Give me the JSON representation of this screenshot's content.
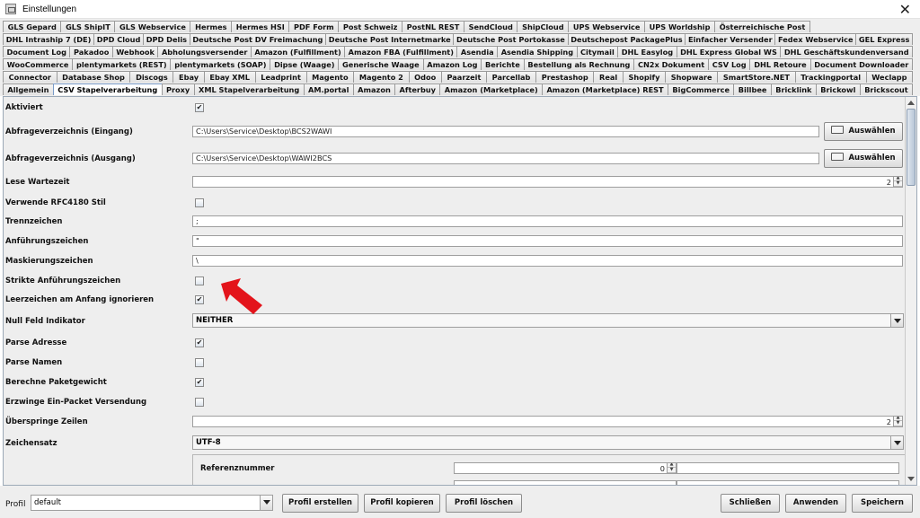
{
  "window": {
    "title": "Einstellungen",
    "close_glyph": "✕",
    "icon": "app-window-icon"
  },
  "tabs": {
    "row1": [
      "GLS Gepard",
      "GLS ShipIT",
      "GLS Webservice",
      "Hermes",
      "Hermes HSI",
      "PDF Form",
      "Post Schweiz",
      "PostNL REST",
      "SendCloud",
      "ShipCloud",
      "UPS Webservice",
      "UPS Worldship",
      "Österreichische Post"
    ],
    "row2": [
      "DHL Intraship 7 (DE)",
      "DPD Cloud",
      "DPD Delis",
      "Deutsche Post DV Freimachung",
      "Deutsche Post Internetmarke",
      "Deutsche Post Portokasse",
      "Deutschepost PackagePlus",
      "Einfacher Versender",
      "Fedex Webservice",
      "GEL Express"
    ],
    "row3": [
      "Document Log",
      "Pakadoo",
      "Webhook",
      "Abholungsversender",
      "Amazon (Fulfillment)",
      "Amazon FBA (Fulfillment)",
      "Asendia",
      "Asendia Shipping",
      "Citymail",
      "DHL Easylog",
      "DHL Express Global WS",
      "DHL Geschäftskundenversand"
    ],
    "row4": [
      "WooCommerce",
      "plentymarkets (REST)",
      "plentymarkets (SOAP)",
      "Dipse (Waage)",
      "Generische Waage",
      "Amazon Log",
      "Berichte",
      "Bestellung als Rechnung",
      "CN2x Dokument",
      "CSV Log",
      "DHL Retoure",
      "Document Downloader"
    ],
    "row5": [
      "Connector",
      "Database Shop",
      "Discogs",
      "Ebay",
      "Ebay XML",
      "Leadprint",
      "Magento",
      "Magento 2",
      "Odoo",
      "Paarzeit",
      "Parcellab",
      "Prestashop",
      "Real",
      "Shopify",
      "Shopware",
      "SmartStore.NET",
      "Trackingportal",
      "Weclapp"
    ],
    "row6": [
      "Allgemein",
      "CSV Stapelverarbeitung",
      "Proxy",
      "XML Stapelverarbeitung",
      "AM.portal",
      "Amazon",
      "Afterbuy",
      "Amazon (Marketplace)",
      "Amazon (Marketplace) REST",
      "BigCommerce",
      "Billbee",
      "Bricklink",
      "Brickowl",
      "Brickscout"
    ],
    "active": "CSV Stapelverarbeitung"
  },
  "form": {
    "aktiviert": {
      "label": "Aktiviert",
      "checked": true
    },
    "input_dir": {
      "label": "Abfrageverzeichnis (Eingang)",
      "value": "C:\\Users\\Service\\Desktop\\BCS2WAWI",
      "button": "Auswählen"
    },
    "output_dir": {
      "label": "Abfrageverzeichnis (Ausgang)",
      "value": "C:\\Users\\Service\\Desktop\\WAWI2BCS",
      "button": "Auswählen"
    },
    "lese_wartezeit": {
      "label": "Lese Wartezeit",
      "value": "2"
    },
    "rfc4180": {
      "label": "Verwende RFC4180 Stil",
      "checked": false
    },
    "trennzeichen": {
      "label": "Trennzeichen",
      "value": ";"
    },
    "anfuehrungszeichen": {
      "label": "Anführungszeichen",
      "value": "\""
    },
    "maskierungszeichen": {
      "label": "Maskierungszeichen",
      "value": "\\"
    },
    "strikte": {
      "label": "Strikte Anführungszeichen",
      "checked": false
    },
    "leerzeichen": {
      "label": "Leerzeichen am Anfang ignorieren",
      "checked": true
    },
    "null_feld": {
      "label": "Null Feld Indikator",
      "value": "NEITHER"
    },
    "parse_adresse": {
      "label": "Parse Adresse",
      "checked": true
    },
    "parse_namen": {
      "label": "Parse Namen",
      "checked": false
    },
    "berechne": {
      "label": "Berechne Paketgewicht",
      "checked": true
    },
    "erzwinge": {
      "label": "Erzwinge Ein-Packet Versendung",
      "checked": false
    },
    "ueberspringe": {
      "label": "Überspringe Zeilen",
      "value": "2"
    },
    "zeichensatz": {
      "label": "Zeichensatz",
      "value": "UTF-8"
    },
    "referenznummer": {
      "label": "Referenznummer",
      "value": "0"
    }
  },
  "footer": {
    "profil_label": "Profil",
    "profil_value": "default",
    "erstellen": "Profil erstellen",
    "kopieren": "Profil kopieren",
    "loeschen": "Profil löschen",
    "schliessen": "Schließen",
    "anwenden": "Anwenden",
    "speichern": "Speichern"
  },
  "glyphs": {
    "check": "✔",
    "spin_up": "▲",
    "spin_down": "▼"
  },
  "colors": {
    "annotation_arrow": "#e3141b",
    "active_tab_border": "#7a9cc9"
  }
}
